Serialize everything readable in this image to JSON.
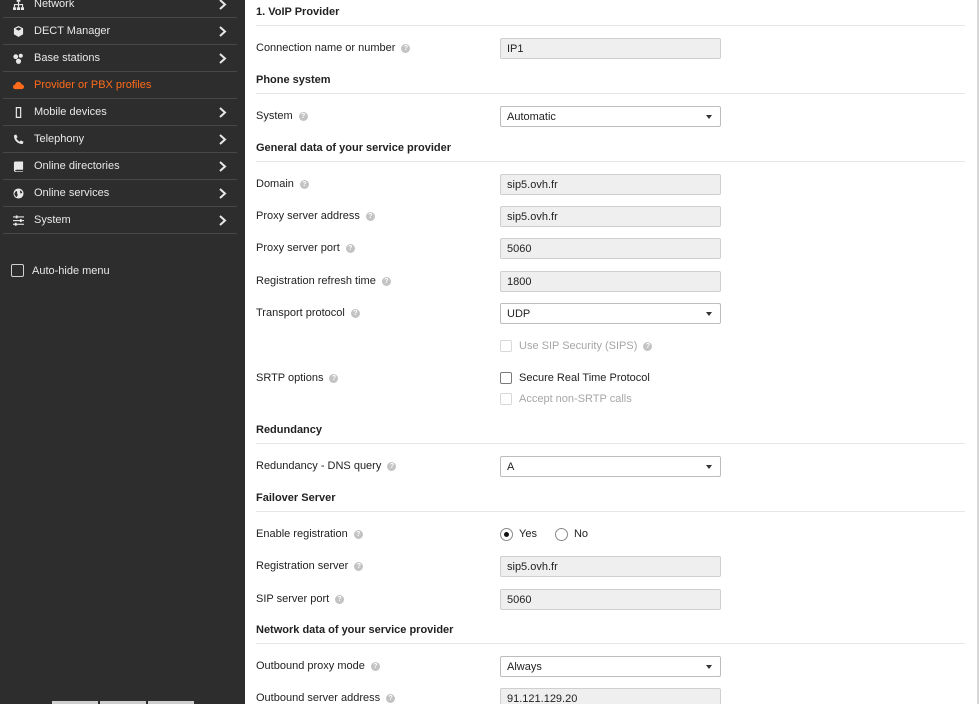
{
  "sidebar": {
    "items": [
      {
        "label": "Network",
        "icon": "network-icon",
        "active": false
      },
      {
        "label": "DECT Manager",
        "icon": "cube-icon",
        "active": false
      },
      {
        "label": "Base stations",
        "icon": "base-stations-icon",
        "active": false
      },
      {
        "label": "Provider or PBX profiles",
        "icon": "cloud-icon",
        "active": true
      },
      {
        "label": "Mobile devices",
        "icon": "mobile-icon",
        "active": false
      },
      {
        "label": "Telephony",
        "icon": "phone-icon",
        "active": false
      },
      {
        "label": "Online directories",
        "icon": "book-icon",
        "active": false
      },
      {
        "label": "Online services",
        "icon": "globe-icon",
        "active": false
      },
      {
        "label": "System",
        "icon": "sliders-icon",
        "active": false
      }
    ],
    "autohide_label": "Auto-hide menu",
    "active_color": "#ff6b1a"
  },
  "form": {
    "sec_voip": "1. VoIP Provider",
    "connection_name_label": "Connection name or number",
    "connection_name_value": "IP1",
    "sec_phone_system": "Phone system",
    "system_label": "System",
    "system_value": "Automatic",
    "sec_general": "General data of your service provider",
    "domain_label": "Domain",
    "domain_value": "sip5.ovh.fr",
    "proxy_address_label": "Proxy server address",
    "proxy_address_value": "sip5.ovh.fr",
    "proxy_port_label": "Proxy server port",
    "proxy_port_value": "5060",
    "reg_refresh_label": "Registration refresh time",
    "reg_refresh_value": "1800",
    "transport_label": "Transport protocol",
    "transport_value": "UDP",
    "sips_label": "Use SIP Security (SIPS)",
    "srtp_label": "SRTP options",
    "srtp_secure_label": "Secure Real Time Protocol",
    "srtp_accept_label": "Accept non-SRTP calls",
    "sec_redundancy": "Redundancy",
    "dns_query_label": "Redundancy - DNS query",
    "dns_query_value": "A",
    "sec_failover": "Failover Server",
    "enable_reg_label": "Enable registration",
    "enable_reg_yes": "Yes",
    "enable_reg_no": "No",
    "reg_server_label": "Registration server",
    "reg_server_value": "sip5.ovh.fr",
    "sip_port_label": "SIP server port",
    "sip_port_value": "5060",
    "sec_network": "Network data of your service provider",
    "outbound_mode_label": "Outbound proxy mode",
    "outbound_mode_value": "Always",
    "outbound_address_label": "Outbound server address",
    "outbound_address_value": "91.121.129.20"
  }
}
